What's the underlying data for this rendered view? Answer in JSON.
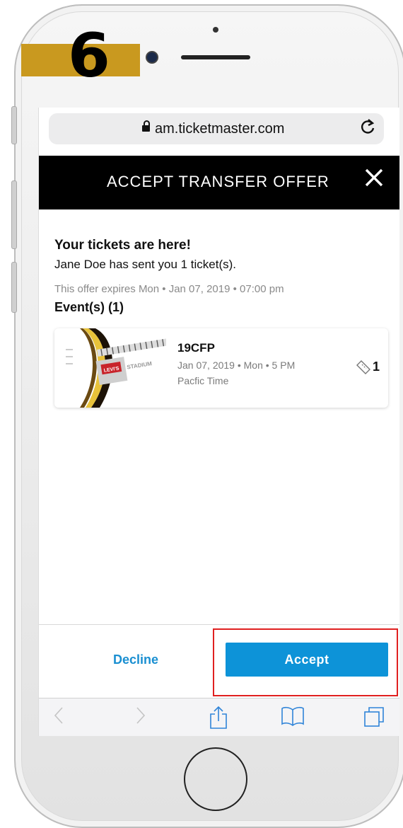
{
  "step": {
    "number": "6",
    "bar_color": "#c9991f"
  },
  "browser": {
    "url": "am.ticketmaster.com",
    "lock_icon": "lock-icon",
    "reload_icon": "reload-icon"
  },
  "header": {
    "title": "ACCEPT TRANSFER OFFER",
    "close_glyph": "✕"
  },
  "offer": {
    "title": "Your tickets are here!",
    "sent_line": "Jane Doe has sent you 1 ticket(s).",
    "expires_line": "This offer expires Mon • Jan 07, 2019 • 07:00 pm",
    "events_label": "Event(s) (1)"
  },
  "event": {
    "name": "19CFP",
    "date_line": "Jan 07, 2019 • Mon • 5 PM",
    "timezone": "Pacfic Time",
    "ticket_count": "1",
    "thumb_text": "LEVI'S STADIUM"
  },
  "actions": {
    "decline_label": "Decline",
    "accept_label": "Accept",
    "accept_color": "#0d93d8",
    "highlight_color": "#e02020"
  },
  "toolbar": {
    "back_glyph": "〈",
    "forward_glyph": "〉"
  }
}
